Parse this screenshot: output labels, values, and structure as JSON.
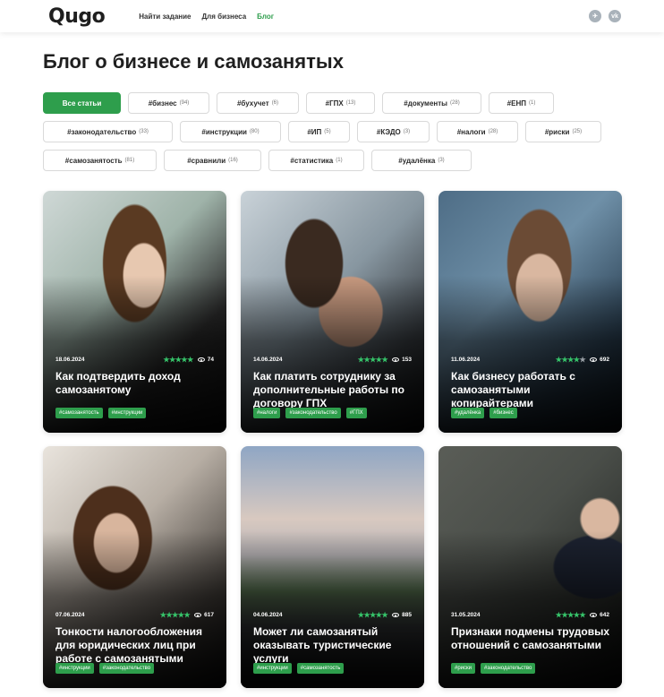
{
  "header": {
    "logo": "Qugo",
    "nav": [
      "Найти задание",
      "Для бизнеса",
      "Блог"
    ],
    "socials": [
      {
        "icon": "telegram-icon",
        "glyph": "✈"
      },
      {
        "icon": "vk-icon",
        "glyph": "vk"
      }
    ]
  },
  "page_title": "Блог о бизнесе и самозанятых",
  "tags": {
    "all": "Все статьи",
    "rows": [
      [
        {
          "label": "#бизнес",
          "count": "(94)"
        },
        {
          "label": "#бухучет",
          "count": "(6)"
        },
        {
          "label": "#ГПХ",
          "count": "(13)"
        },
        {
          "label": "#документы",
          "count": "(28)"
        },
        {
          "label": "#ЕНП",
          "count": "(1)"
        }
      ],
      [
        {
          "label": "#законодательство",
          "count": "(33)"
        },
        {
          "label": "#инструкции",
          "count": "(80)"
        },
        {
          "label": "#ИП",
          "count": "(5)"
        },
        {
          "label": "#КЭДО",
          "count": "(3)"
        },
        {
          "label": "#налоги",
          "count": "(28)"
        },
        {
          "label": "#риски",
          "count": "(25)"
        }
      ],
      [
        {
          "label": "#самозанятость",
          "count": "(81)"
        },
        {
          "label": "#сравнили",
          "count": "(16)"
        },
        {
          "label": "#статистика",
          "count": "(1)"
        },
        {
          "label": "#удалёнка",
          "count": "(3)"
        }
      ]
    ]
  },
  "articles": [
    {
      "date": "18.06.2024",
      "rating": 5,
      "views": "74",
      "title": "Как подтвердить доход самозанятому",
      "tags": [
        "#самозанятость",
        "#инструкции"
      ]
    },
    {
      "date": "14.06.2024",
      "rating": 5,
      "views": "153",
      "title": "Как платить сотруднику за дополнительные работы по договору ГПХ",
      "tags": [
        "#налоги",
        "#законодательство",
        "#ГПХ"
      ]
    },
    {
      "date": "11.06.2024",
      "rating": 4,
      "views": "692",
      "title": "Как бизнесу работать с самозанятыми копирайтерами",
      "tags": [
        "#удалёнка",
        "#бизнес"
      ]
    },
    {
      "date": "07.06.2024",
      "rating": 5,
      "views": "617",
      "title": "Тонкости налогообложения для юридических лиц при работе с самозанятыми",
      "tags": [
        "#инструкции",
        "#законодательство"
      ]
    },
    {
      "date": "04.06.2024",
      "rating": 5,
      "views": "885",
      "title": "Может ли самозанятый оказывать туристические услуги",
      "tags": [
        "#инструкции",
        "#самозанятость"
      ]
    },
    {
      "date": "31.05.2024",
      "rating": 5,
      "views": "642",
      "title": "Признаки подмены трудовых отношений с самозанятыми",
      "tags": [
        "#риски",
        "#законодательство"
      ]
    }
  ],
  "colors": {
    "accent": "#2e9e4c",
    "stars": "#36c46a"
  }
}
